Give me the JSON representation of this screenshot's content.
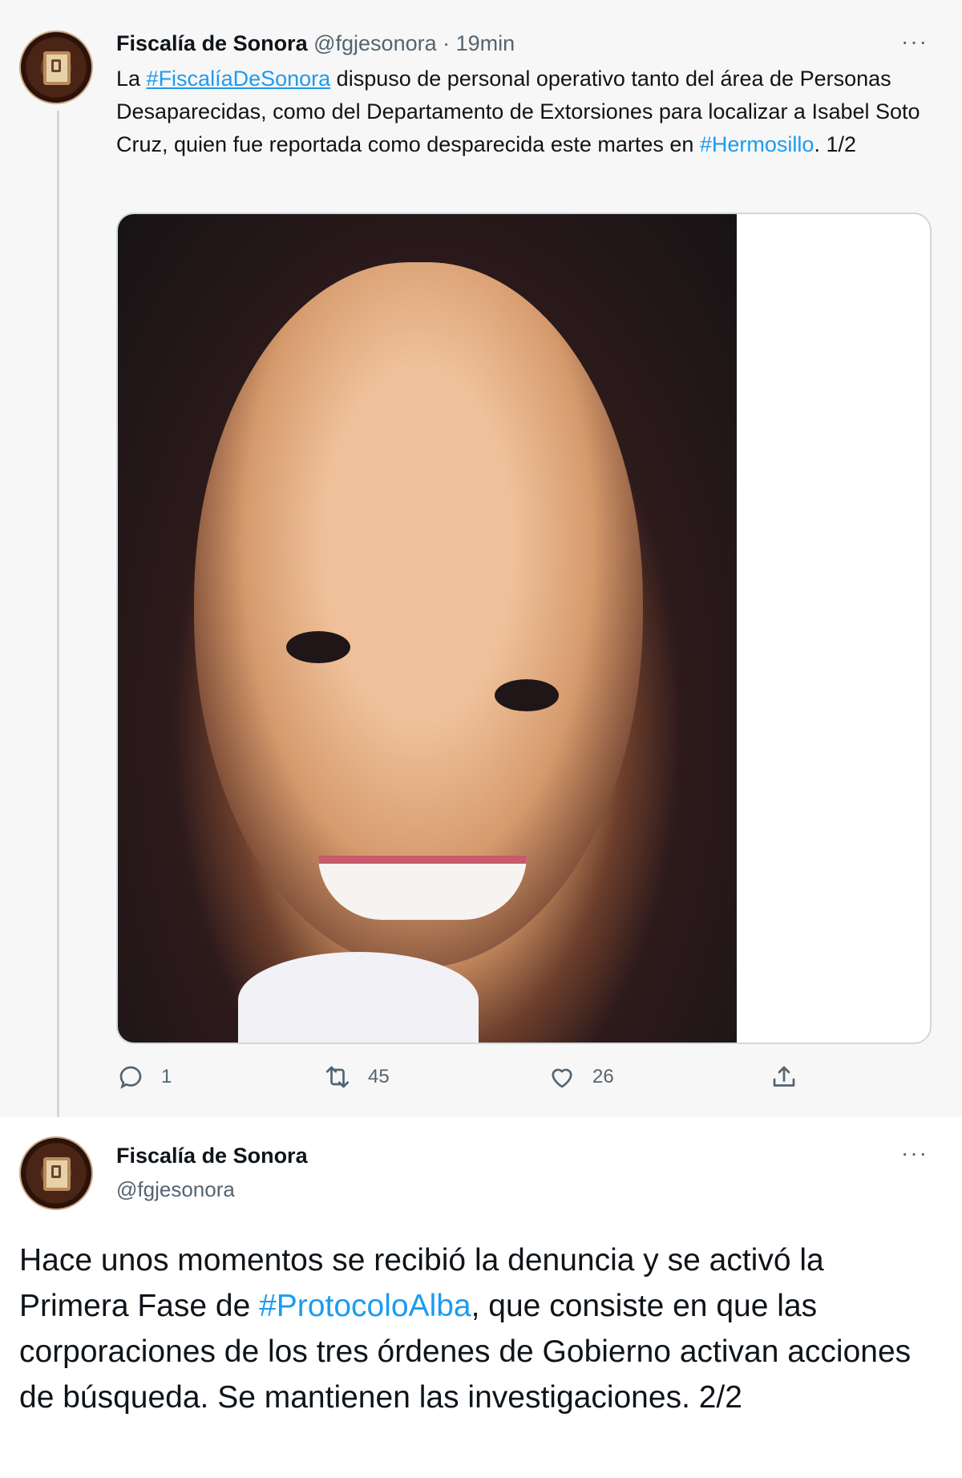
{
  "tweet1": {
    "author_name": "Fiscalía de Sonora",
    "handle": "@fgjesonora",
    "separator": "·",
    "time": "19min",
    "more_label": "···",
    "text": {
      "part1": "La ",
      "hashtag1": "#FiscalíaDeSonora",
      "part2": " dispuso de personal operativo tanto del área de Personas Desaparecidas,  como del Departamento de  Extorsiones para localizar a Isabel Soto Cruz, quien fue reportada como desparecida este martes en ",
      "hashtag2": "#Hermosillo",
      "part3": ". 1/2"
    },
    "actions": {
      "reply_count": "1",
      "retweet_count": "45",
      "like_count": "26"
    }
  },
  "tweet2": {
    "author_name": "Fiscalía de Sonora",
    "handle": "@fgjesonora",
    "more_label": "···",
    "text": {
      "part1": "Hace unos momentos se recibió la denuncia y se activó la Primera Fase de ",
      "hashtag": "#ProtocoloAlba",
      "part2": ", que consiste en que las corporaciones de los tres órdenes de Gobierno activan acciones de búsqueda. Se mantienen las investigaciones. 2/2"
    }
  },
  "colors": {
    "link": "#1d9bf0",
    "secondary_text": "#536471",
    "primary_text": "#0f1419",
    "thread_line": "#cfd9de",
    "highlight_bg": "#f7f7f7"
  },
  "icons": [
    "reply-icon",
    "retweet-icon",
    "like-icon",
    "share-icon",
    "more-icon"
  ]
}
